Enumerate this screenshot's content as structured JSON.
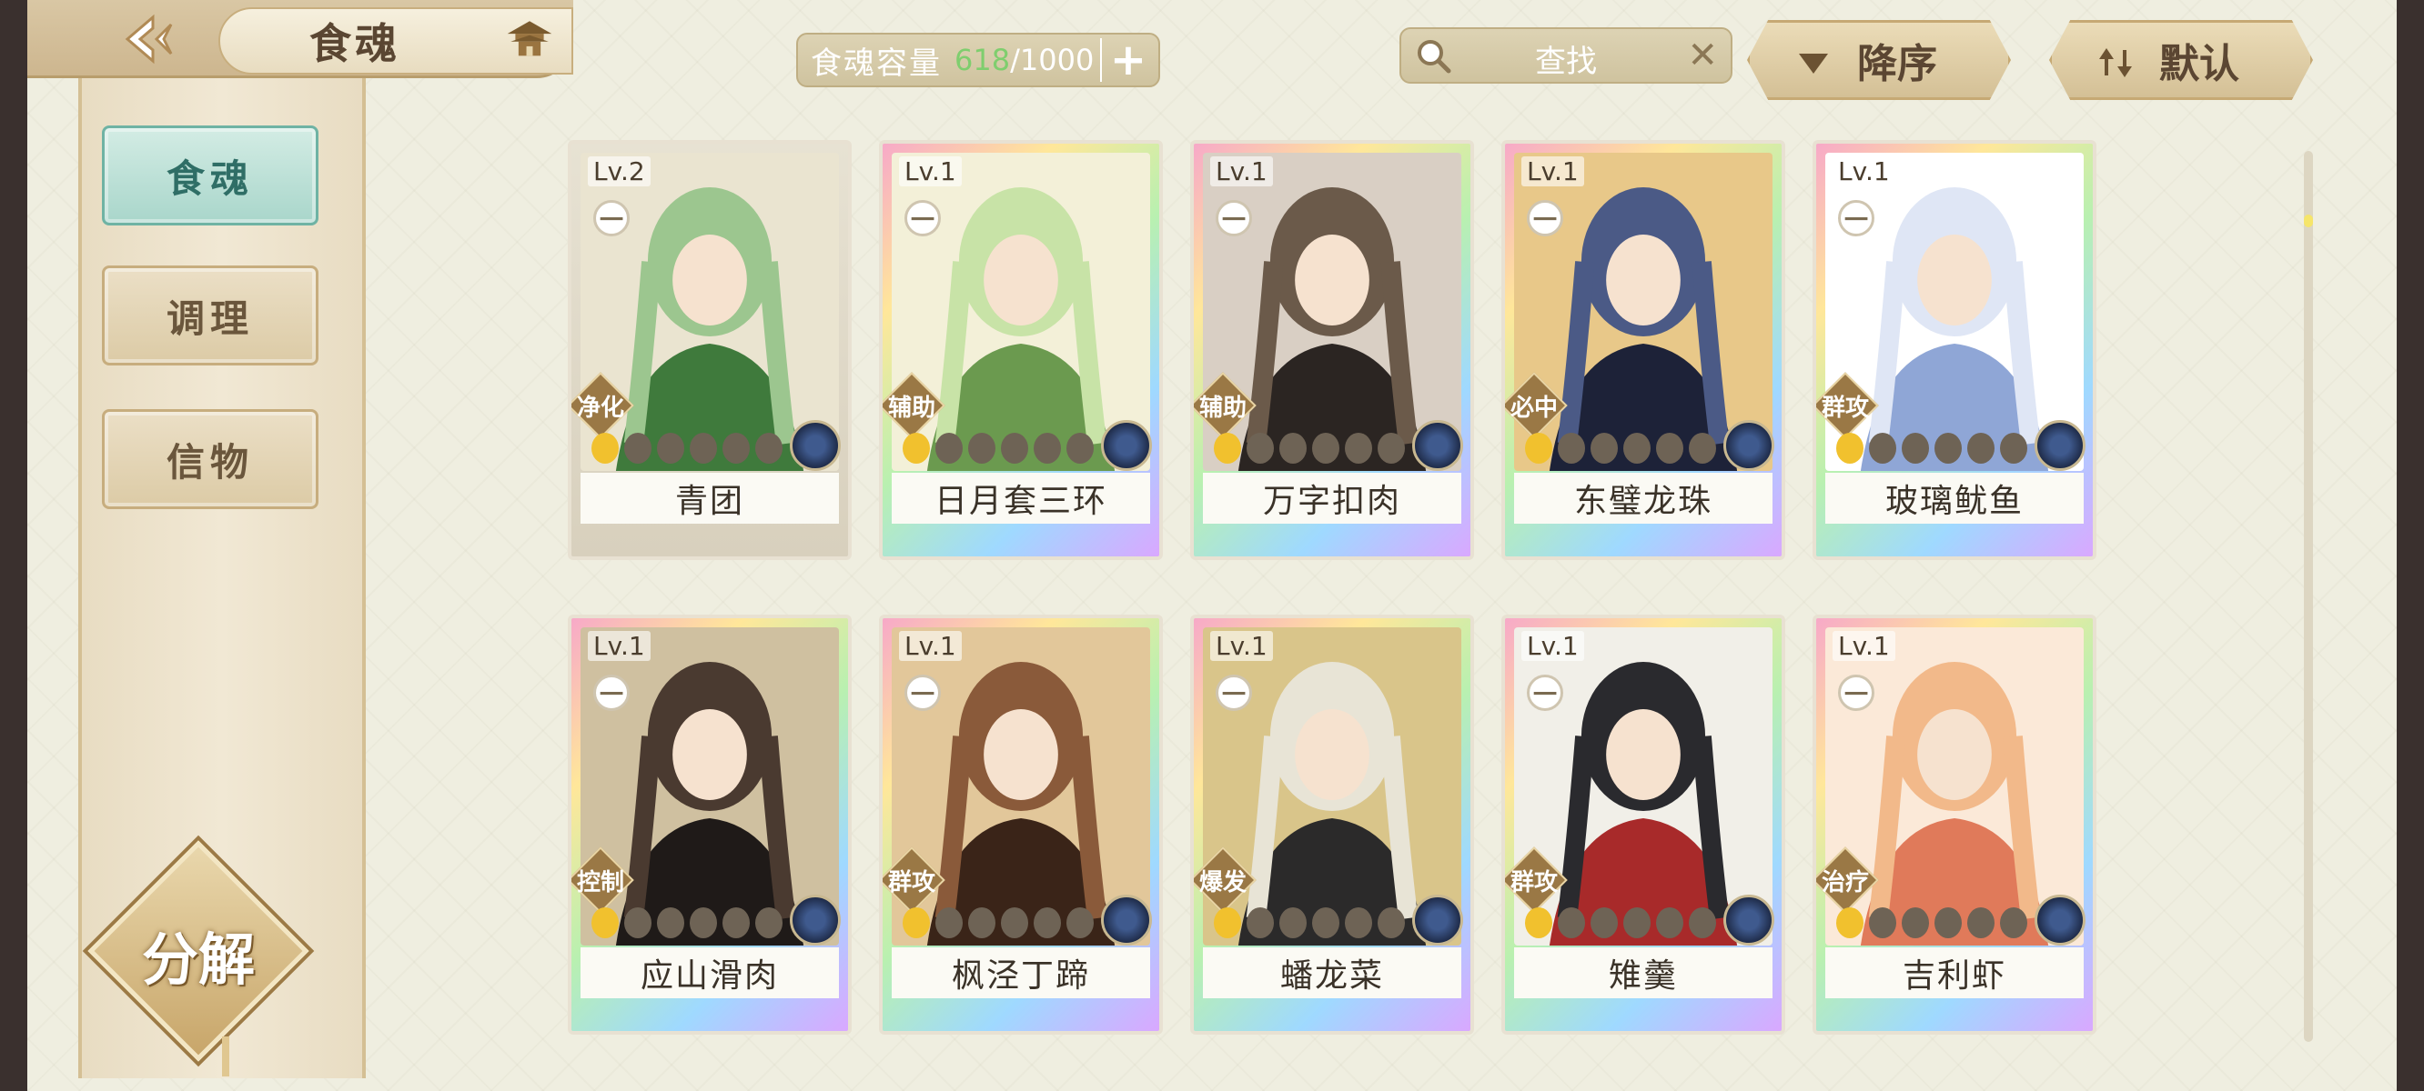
{
  "header": {
    "title": "食魂",
    "capacity_label": "食魂容量",
    "capacity_current": "618",
    "capacity_max": "/1000",
    "search_placeholder": "查找",
    "sort_order_label": "降序",
    "sort_default_label": "默认"
  },
  "sidebar": {
    "tabs": [
      {
        "label": "食魂",
        "active": true
      },
      {
        "label": "调理",
        "active": false
      },
      {
        "label": "信物",
        "active": false
      }
    ],
    "decompose_label": "分解"
  },
  "cards": [
    {
      "level": "Lv.2",
      "role": "净化",
      "name": "青团",
      "stars": 1,
      "frame": "plain",
      "palette": [
        "#9cc68f",
        "#3f7a3c",
        "#eae4d0"
      ]
    },
    {
      "level": "Lv.1",
      "role": "辅助",
      "name": "日月套三环",
      "stars": 1,
      "frame": "rainbow",
      "palette": [
        "#c8e3a7",
        "#6b9a4f",
        "#f3f0d8"
      ]
    },
    {
      "level": "Lv.1",
      "role": "辅助",
      "name": "万字扣肉",
      "stars": 1,
      "frame": "rainbow",
      "palette": [
        "#6b5a4a",
        "#2b2522",
        "#d9cfc4"
      ]
    },
    {
      "level": "Lv.1",
      "role": "必中",
      "name": "东璧龙珠",
      "stars": 1,
      "frame": "rainbow",
      "palette": [
        "#4b5a86",
        "#1d2238",
        "#e8c889"
      ]
    },
    {
      "level": "Lv.1",
      "role": "群攻",
      "name": "玻璃鱿鱼",
      "stars": 1,
      "frame": "rainbow",
      "palette": [
        "#dfe6f5",
        "#8fa6d6",
        "#ffffff"
      ]
    },
    {
      "level": "Lv.1",
      "role": "控制",
      "name": "应山滑肉",
      "stars": 1,
      "frame": "rainbow",
      "palette": [
        "#4a3a30",
        "#1f1a18",
        "#cfc0a0"
      ]
    },
    {
      "level": "Lv.1",
      "role": "群攻",
      "name": "枫泾丁蹄",
      "stars": 1,
      "frame": "rainbow",
      "palette": [
        "#8a5a3a",
        "#3a2418",
        "#e2c79a"
      ]
    },
    {
      "level": "Lv.1",
      "role": "爆发",
      "name": "蟠龙菜",
      "stars": 1,
      "frame": "rainbow",
      "palette": [
        "#e8e4d6",
        "#2b2a2a",
        "#d9c58a"
      ]
    },
    {
      "level": "Lv.1",
      "role": "群攻",
      "name": "雉羹",
      "stars": 1,
      "frame": "rainbow",
      "palette": [
        "#2a2a2e",
        "#a82a2a",
        "#f1efe8"
      ]
    },
    {
      "level": "Lv.1",
      "role": "治疗",
      "name": "吉利虾",
      "stars": 1,
      "frame": "rainbow",
      "palette": [
        "#f2b98a",
        "#e07a5a",
        "#fbe9d8"
      ]
    }
  ],
  "colors": {
    "accent_teal": "#a9d6cb",
    "capacity_current": "#7fce6e",
    "gold": "#c8a66a"
  }
}
